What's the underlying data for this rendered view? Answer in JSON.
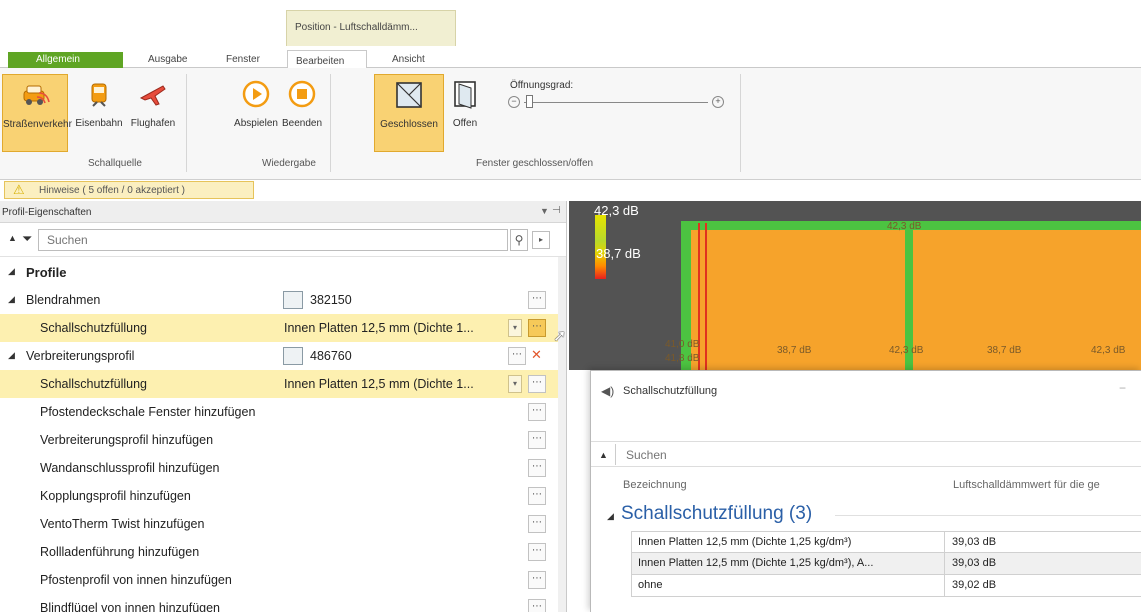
{
  "ribbon_tabs": {
    "context_group": "Position - Luftschalldämm...",
    "allgemein": "Allgemein",
    "ausgabe": "Ausgabe",
    "fenster": "Fenster",
    "bearbeiten": "Bearbeiten",
    "ansicht": "Ansicht"
  },
  "ribbon": {
    "schallquelle": {
      "label": "Schallquelle",
      "buttons": [
        "Straßenverkehr",
        "Eisenbahn",
        "Flughafen"
      ]
    },
    "wiedergabe": {
      "label": "Wiedergabe",
      "buttons": [
        "Abspielen",
        "Beenden"
      ]
    },
    "fenster": {
      "label": "Fenster geschlossen/offen",
      "buttons": [
        "Geschlossen",
        "Offen"
      ],
      "slider_label": "Öffnungsgrad:",
      "slider_value": 0
    }
  },
  "hint": "Hinweise ( 5 offen / 0 akzeptiert )",
  "panel": {
    "title": "Profil-Eigenschaften",
    "search_placeholder": "Suchen",
    "rows": [
      {
        "name": "Profile",
        "bold": true
      },
      {
        "name": "Blendrahmen",
        "value": "382150"
      },
      {
        "name": "Schallschutzfüllung",
        "value": "Innen Platten 12,5 mm (Dichte 1..."
      },
      {
        "name": "Verbreiterungsprofil",
        "value": "486760"
      },
      {
        "name": "Schallschutzfüllung",
        "value": "Innen Platten 12,5 mm (Dichte 1..."
      },
      {
        "name": "Pfostendeckschale Fenster hinzufügen"
      },
      {
        "name": "Verbreiterungsprofil hinzufügen"
      },
      {
        "name": "Wandanschlussprofil hinzufügen"
      },
      {
        "name": "Kopplungsprofil hinzufügen"
      },
      {
        "name": "VentoTherm Twist hinzufügen"
      },
      {
        "name": "Rollladenführung hinzufügen"
      },
      {
        "name": "Pfostenprofil von innen hinzufügen"
      },
      {
        "name": "Blindflügel von innen hinzufügen"
      }
    ]
  },
  "preview": {
    "legend_top": "42,3 dB",
    "legend_mid": "38,7 dB",
    "labels": [
      "42,3 dB",
      "41,0 dB",
      "41,8 dB",
      "38,7 dB",
      "42,3 dB",
      "38,7 dB",
      "42,3 dB"
    ]
  },
  "dialog": {
    "title": "Schallschutzfüllung",
    "search_placeholder": "Suchen",
    "col_bezeichnung": "Bezeichnung",
    "col_luftschall": "Luftschalldämmwert für die ge",
    "group_title": "Schallschutzfüllung (3)",
    "rows": [
      {
        "name": "Innen Platten 12,5 mm (Dichte 1,25 kg/dm³)",
        "value": "39,03 dB"
      },
      {
        "name": "Innen Platten 12,5 mm (Dichte 1,25 kg/dm³), A...",
        "value": "39,03 dB"
      },
      {
        "name": "ohne",
        "value": "39,02 dB"
      }
    ]
  },
  "colors": {
    "accent_green": "#5fa524",
    "selected_yellow": "#f9d273",
    "frame_green": "#4cc341",
    "pane_orange": "#f6a32b",
    "group_title_blue": "#2a5fa7"
  }
}
